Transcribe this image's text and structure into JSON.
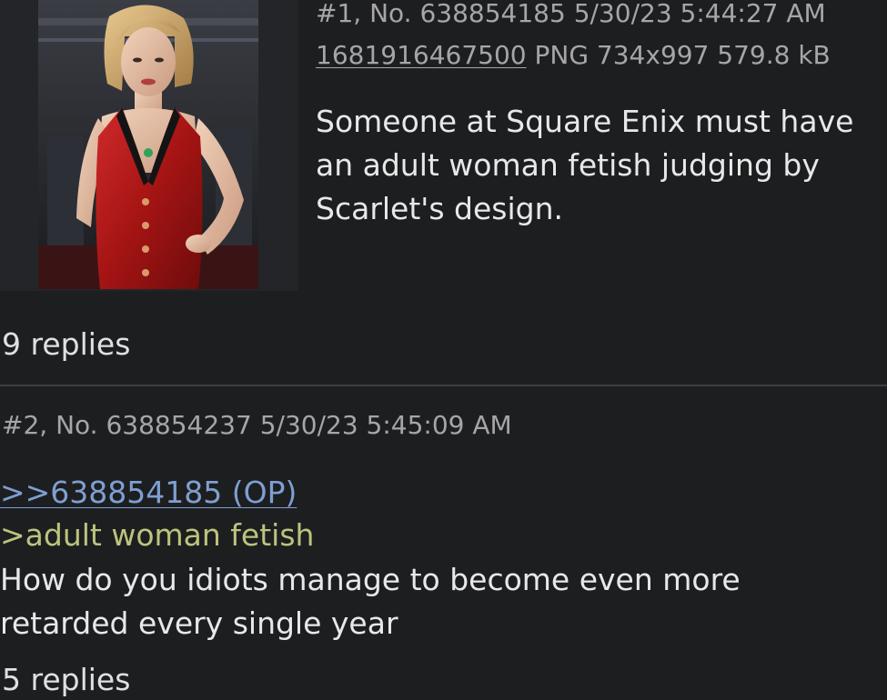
{
  "posts": [
    {
      "header": "#1, No. 638854185 5/30/23 5:44:27 AM",
      "file": {
        "name": "1681916467500",
        "info": "PNG 734x997 579.8 kB"
      },
      "body_lines": [
        "Someone at Square Enix must have",
        "an adult woman fetish judging by",
        "Scarlet's design."
      ],
      "replies": "9 replies",
      "thumbnail_icon": "post-image-thumbnail"
    },
    {
      "header": "#2, No. 638854237 5/30/23 5:45:09 AM",
      "quote_link": ">>638854185 (OP)",
      "greentext": ">adult woman fetish",
      "body_lines": [
        "How do you idiots manage to become even more",
        "retarded every single year"
      ],
      "replies": "5 replies"
    }
  ],
  "colors": {
    "background": "#1d1e20",
    "meta_text": "#a6a6a6",
    "body_text": "#e8e8e8",
    "link": "#7e9fd1",
    "greentext": "#bdc37e",
    "divider": "#3d3f43"
  }
}
